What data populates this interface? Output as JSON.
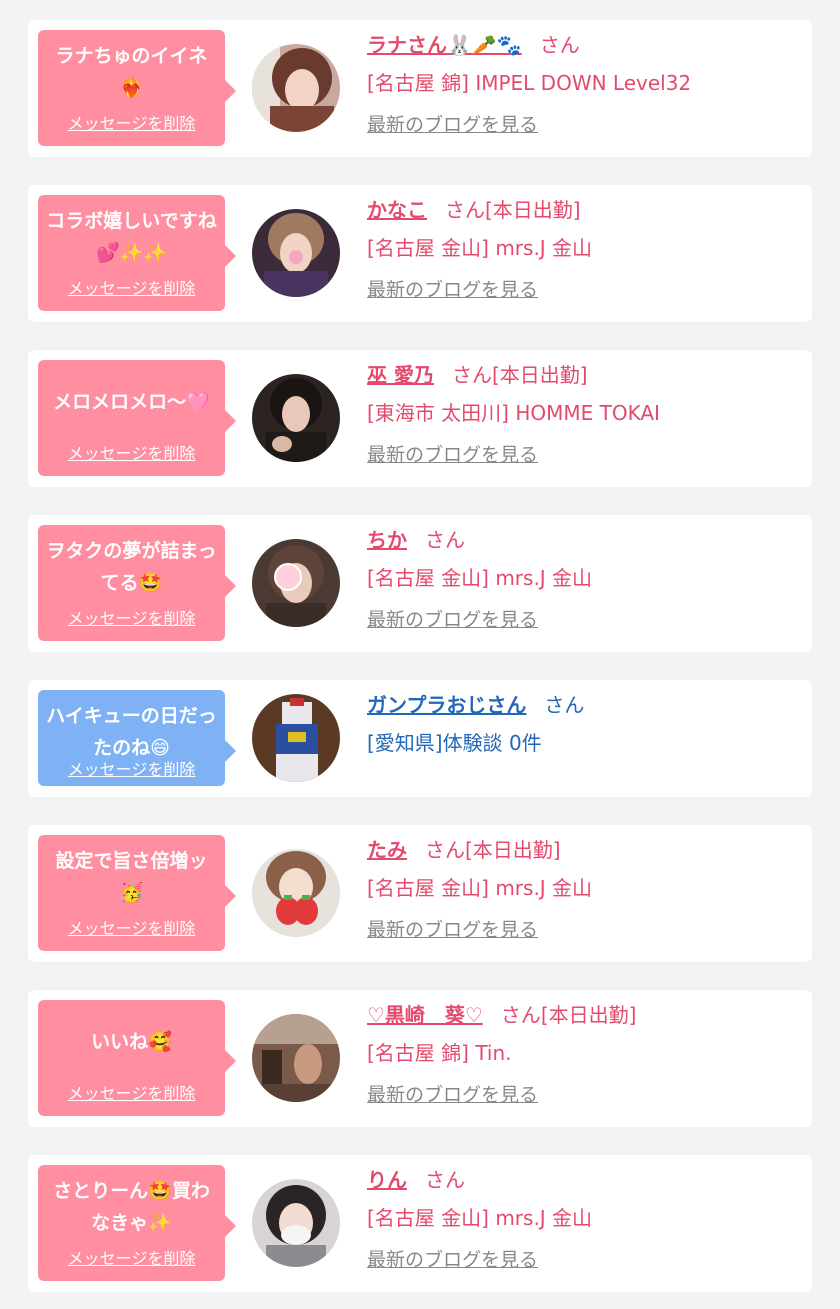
{
  "colors": {
    "pink_bubble": "#ff8fa0",
    "blue_bubble": "#7fb2f4",
    "pink_text": "#e44a6c",
    "blue_text": "#2368b8",
    "blog_link": "#888888"
  },
  "items": [
    {
      "message": "ラナちゅのイイネ❤️‍🔥",
      "delete_label": "メッセージを削除",
      "name": "ラナさん🐰🥕🐾",
      "suffix": "さん",
      "shop": "[名古屋 錦] IMPEL DOWN Level32",
      "blog_link": "最新のブログを見る",
      "theme": "pink",
      "avatar_icon": "girl-portrait-photo"
    },
    {
      "message": "コラボ嬉しいですね💕✨✨",
      "delete_label": "メッセージを削除",
      "name": "かなこ",
      "suffix": "さん[本日出勤]",
      "shop": "[名古屋 金山] mrs.J 金山",
      "blog_link": "最新のブログを見る",
      "theme": "pink",
      "avatar_icon": "girl-portrait-photo"
    },
    {
      "message": "メロメロメロ〜🩷",
      "delete_label": "メッセージを削除",
      "name": "巫 愛乃",
      "suffix": "さん[本日出勤]",
      "shop": "[東海市 太田川] HOMME TOKAI",
      "blog_link": "最新のブログを見る",
      "theme": "pink",
      "avatar_icon": "girl-portrait-photo"
    },
    {
      "message": "ヲタクの夢が詰まってる🤩",
      "delete_label": "メッセージを削除",
      "name": "ちか",
      "suffix": "さん",
      "shop": "[名古屋 金山] mrs.J 金山",
      "blog_link": "最新のブログを見る",
      "theme": "pink",
      "avatar_icon": "girl-portrait-photo"
    },
    {
      "message": "ハイキューの日だったのね😄",
      "delete_label": "メッセージを削除",
      "name": "ガンプラおじさん",
      "suffix": "さん",
      "shop": "[愛知県]体験談 0件",
      "blog_link": "",
      "theme": "blue",
      "avatar_icon": "gundam-model-photo"
    },
    {
      "message": "設定で旨さ倍増ッ🥳",
      "delete_label": "メッセージを削除",
      "name": "たみ",
      "suffix": "さん[本日出勤]",
      "shop": "[名古屋 金山] mrs.J 金山",
      "blog_link": "最新のブログを見る",
      "theme": "pink",
      "avatar_icon": "girl-portrait-photo"
    },
    {
      "message": "いいね🥰",
      "delete_label": "メッセージを削除",
      "name": "♡黒崎　葵♡",
      "suffix": "さん[本日出勤]",
      "shop": "[名古屋 錦] Tin.",
      "blog_link": "最新のブログを見る",
      "theme": "pink",
      "avatar_icon": "girl-portrait-photo"
    },
    {
      "message": "さとりーん🤩買わなきゃ✨",
      "delete_label": "メッセージを削除",
      "name": "りん",
      "suffix": "さん",
      "shop": "[名古屋 金山] mrs.J 金山",
      "blog_link": "最新のブログを見る",
      "theme": "pink",
      "avatar_icon": "girl-portrait-photo"
    }
  ]
}
